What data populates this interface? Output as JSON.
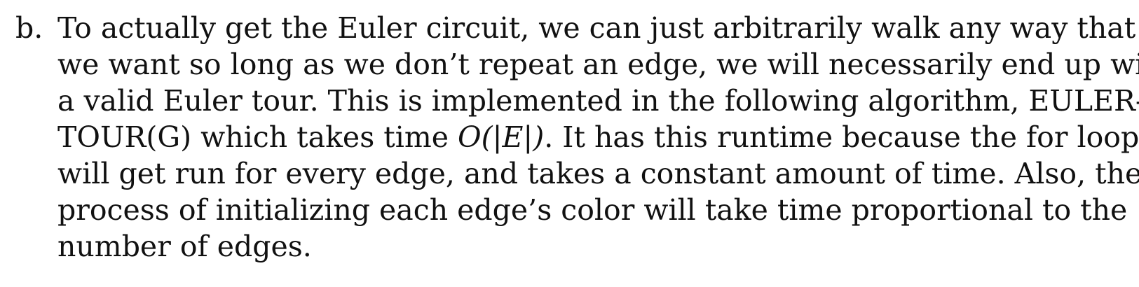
{
  "item": {
    "label": "b.",
    "lines": [
      "To actually get the Euler circuit, we can just arbitrarily walk any way that",
      "we want so long as we don’t repeat an edge, we will necessarily end up with",
      "a valid Euler tour. This is implemented in the following algorithm, EULER-",
      {
        "before": "TOUR(G) which takes time ",
        "math": "O(|E|)",
        "after": ". It has this runtime because the for loop"
      },
      "will get run for every edge, and takes a constant amount of time. Also, the",
      "process of initializing each edge’s color will take time proportional to the",
      "number of edges."
    ]
  }
}
